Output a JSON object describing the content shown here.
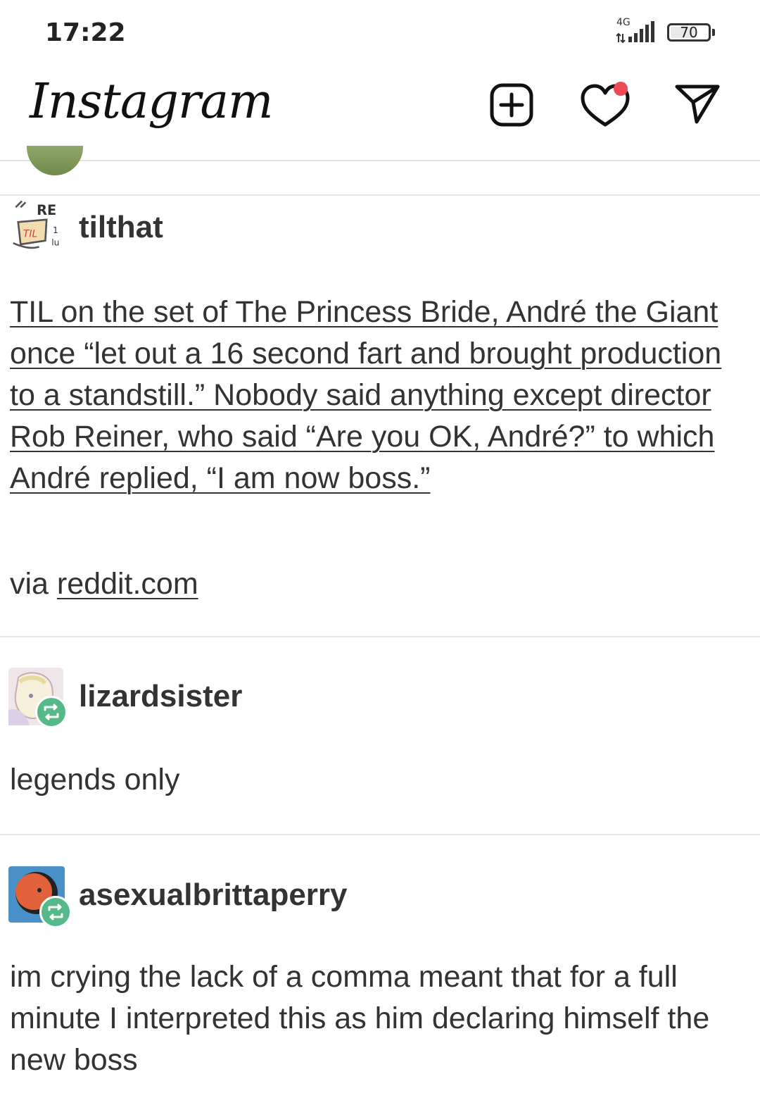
{
  "status_bar": {
    "time": "17:22",
    "network": "4G",
    "battery": "70",
    "battery_level": 0.7
  },
  "app_bar": {
    "logo": "Instagram",
    "icons": [
      "new-post-icon",
      "activity-heart-icon",
      "direct-message-icon"
    ],
    "notification_dot_color": "#ed4956"
  },
  "posts": [
    {
      "username": "tilthat",
      "body": "TIL on the set of The Princess Bride, André the Giant once “let out a 16 second fart and brought production to a standstill.” Nobody said anything except director Rob Reiner, who said “Are you OK, André?” to which André replied, “I am now boss.”",
      "source_prefix": "via ",
      "source_link": "reddit.com"
    },
    {
      "username": "lizardsister",
      "body": "legends only"
    },
    {
      "username": "asexualbrittaperry",
      "body": "im crying the lack of a comma meant that for a full minute I interpreted this as him declaring himself the new boss"
    }
  ],
  "colors": {
    "reblog_badge": "#56b98a",
    "avatar_blue": "#4a90c8",
    "avatar_orange": "#e0613a"
  }
}
